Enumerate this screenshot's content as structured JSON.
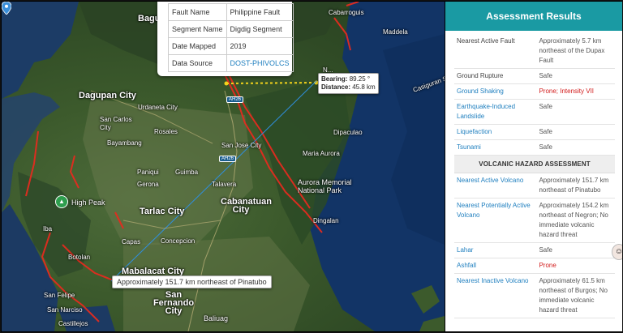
{
  "map": {
    "places": {
      "baguio": "Bagu",
      "cabarroguis": "Cabarroguis",
      "maddela": "Maddela",
      "dagupan": "Dagupan City",
      "urdaneta": "Urdaneta City",
      "san_carlos": "San Carlos City",
      "rosales": "Rosales",
      "bayambang": "Bayambang",
      "san_jose": "San Jose City",
      "dipaculao": "Dipaculao",
      "maria_aurora": "Maria Aurora",
      "paniqui": "Paniqui",
      "gerona": "Gerona",
      "guimba": "Guimba",
      "aurora_park": "Aurora Memorial National Park",
      "high_peak": "High Peak",
      "tarlac": "Tarlac City",
      "talavera": "Talavera",
      "cabanatuan": "Cabanatuan City",
      "dingalan": "Dingalan",
      "iba": "Iba",
      "capas": "Capas",
      "concepcion": "Concepcion",
      "botolan": "Botolan",
      "mabalacat": "Mabalacat City",
      "san_felipe": "San Felipe",
      "san_narciso": "San Narciso",
      "san_fernando": "San Fernando City",
      "baliuag": "Baliuag",
      "castillejos": "Castillejos",
      "casiguran": "Casiguran Sou",
      "nagtipunan": "N..."
    },
    "roads": {
      "ah26_north": "AH26",
      "ah26_south": "AH26"
    },
    "popup": {
      "rows": [
        {
          "label": "Fault Name",
          "value": "Philippine Fault"
        },
        {
          "label": "Segment Name",
          "value": "Digdig Segment"
        },
        {
          "label": "Date Mapped",
          "value": "2019"
        },
        {
          "label": "Data Source",
          "value": "DOST-PHIVOLCS"
        }
      ]
    },
    "bearing": {
      "bearing_label": "Bearing:",
      "bearing_value": "89.25 °",
      "distance_label": "Distance:",
      "distance_value": "45.8 km"
    },
    "tooltip": "Approximately 151.7 km northeast of Pinatubo",
    "colors": {
      "fault": "#e52b1f",
      "measure": "#f4d41b",
      "line": "#2f8fe0"
    }
  },
  "panel": {
    "title": "Assessment Results",
    "rows": [
      {
        "label": "Nearest Active Fault",
        "value": "Approximately 5.7 km northeast of the Dupax Fault",
        "link": false,
        "red": false
      },
      {
        "label": "Ground Rupture",
        "value": "Safe",
        "link": false,
        "red": false
      },
      {
        "label": "Ground Shaking",
        "value": "Prone; Intensity VII",
        "link": true,
        "red": true
      },
      {
        "label": "Earthquake-Induced Landslide",
        "value": "Safe",
        "link": true,
        "red": false
      },
      {
        "label": "Liquefaction",
        "value": "Safe",
        "link": true,
        "red": false
      },
      {
        "label": "Tsunami",
        "value": "Safe",
        "link": true,
        "red": false
      }
    ],
    "volcanic_section": "VOLCANIC HAZARD ASSESSMENT",
    "volcanic_rows": [
      {
        "label": "Nearest Active Volcano",
        "value": "Approximately 151.7 km northeast of Pinatubo",
        "red": false
      },
      {
        "label": "Nearest Potentially Active Volcano",
        "value": "Approximately 154.2 km northeast of Negron; No immediate volcanic hazard threat",
        "red": false
      },
      {
        "label": "Lahar",
        "value": "Safe",
        "red": false
      },
      {
        "label": "Ashfall",
        "value": "Prone",
        "red": true
      },
      {
        "label": "Nearest Inactive Volcano",
        "value": "Approximately 61.5 km northeast of Burgos; No immediate volcanic hazard threat",
        "red": false
      }
    ],
    "colors": {
      "header": "#1a9aa3",
      "link": "#1f7fbf",
      "danger": "#d21c1c"
    }
  }
}
